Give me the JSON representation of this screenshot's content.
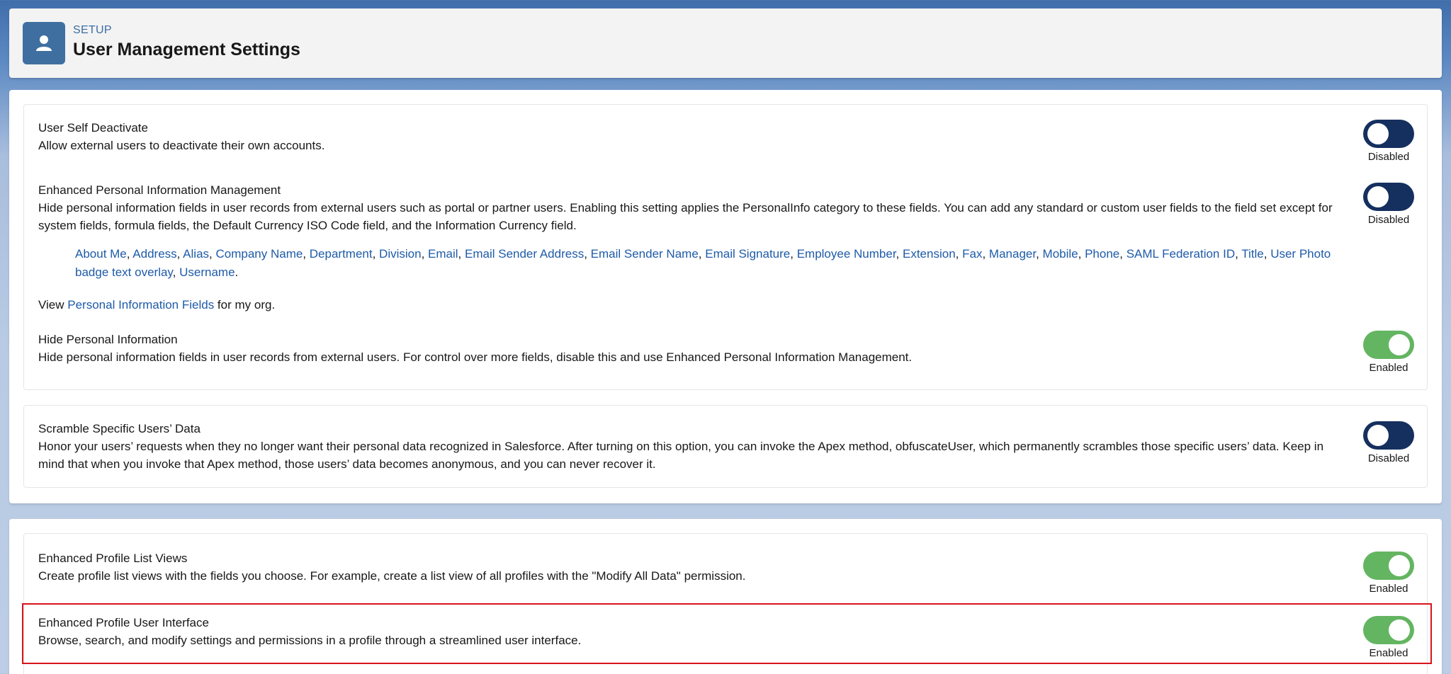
{
  "header": {
    "eyebrow": "SETUP",
    "title": "User Management Settings",
    "icon": "user-icon"
  },
  "settings": [
    {
      "title": "User Self Deactivate",
      "description": "Allow external users to deactivate their own accounts.",
      "state": "Disabled"
    },
    {
      "title": "Enhanced Personal Information Management",
      "description": "Hide personal information fields in user records from external users such as portal or partner users. Enabling this setting applies the PersonalInfo category to these fields. You can add any standard or custom user fields to the field set except for system fields, formula fields, the Default Currency ISO Code field, and the Information Currency field.",
      "state": "Disabled",
      "fields": [
        "About Me",
        "Address",
        "Alias",
        "Company Name",
        "Department",
        "Division",
        "Email",
        "Email Sender Address",
        "Email Sender Name",
        "Email Signature",
        "Employee Number",
        "Extension",
        "Fax",
        "Manager",
        "Mobile",
        "Phone",
        "SAML Federation ID",
        "Title",
        "User Photo badge text overlay",
        "Username"
      ],
      "view_prefix": "View ",
      "view_link": "Personal Information Fields",
      "view_suffix": " for my org."
    },
    {
      "title": "Hide Personal Information",
      "description": "Hide personal information fields in user records from external users. For control over more fields, disable this and use Enhanced Personal Information Management.",
      "state": "Enabled"
    },
    {
      "title": "Scramble Specific Users’ Data",
      "description": "Honor your users’ requests when they no longer want their personal data recognized in Salesforce. After turning on this option, you can invoke the Apex method, obfuscateUser, which permanently scrambles those specific users’ data. Keep in mind that when you invoke that Apex method, those users’ data becomes anonymous, and you can never recover it.",
      "state": "Disabled"
    },
    {
      "title": "Enhanced Profile List Views",
      "description": "Create profile list views with the fields you choose. For example, create a list view of all profiles with the \"Modify All Data\" permission.",
      "state": "Enabled"
    },
    {
      "title": "Enhanced Profile User Interface",
      "description": "Browse, search, and modify settings and permissions in a profile through a streamlined user interface.",
      "state": "Enabled"
    }
  ],
  "colors": {
    "toggle_off": "#15305f",
    "toggle_on": "#64b561",
    "link": "#1e5ba8",
    "highlight": "#d8141b"
  }
}
